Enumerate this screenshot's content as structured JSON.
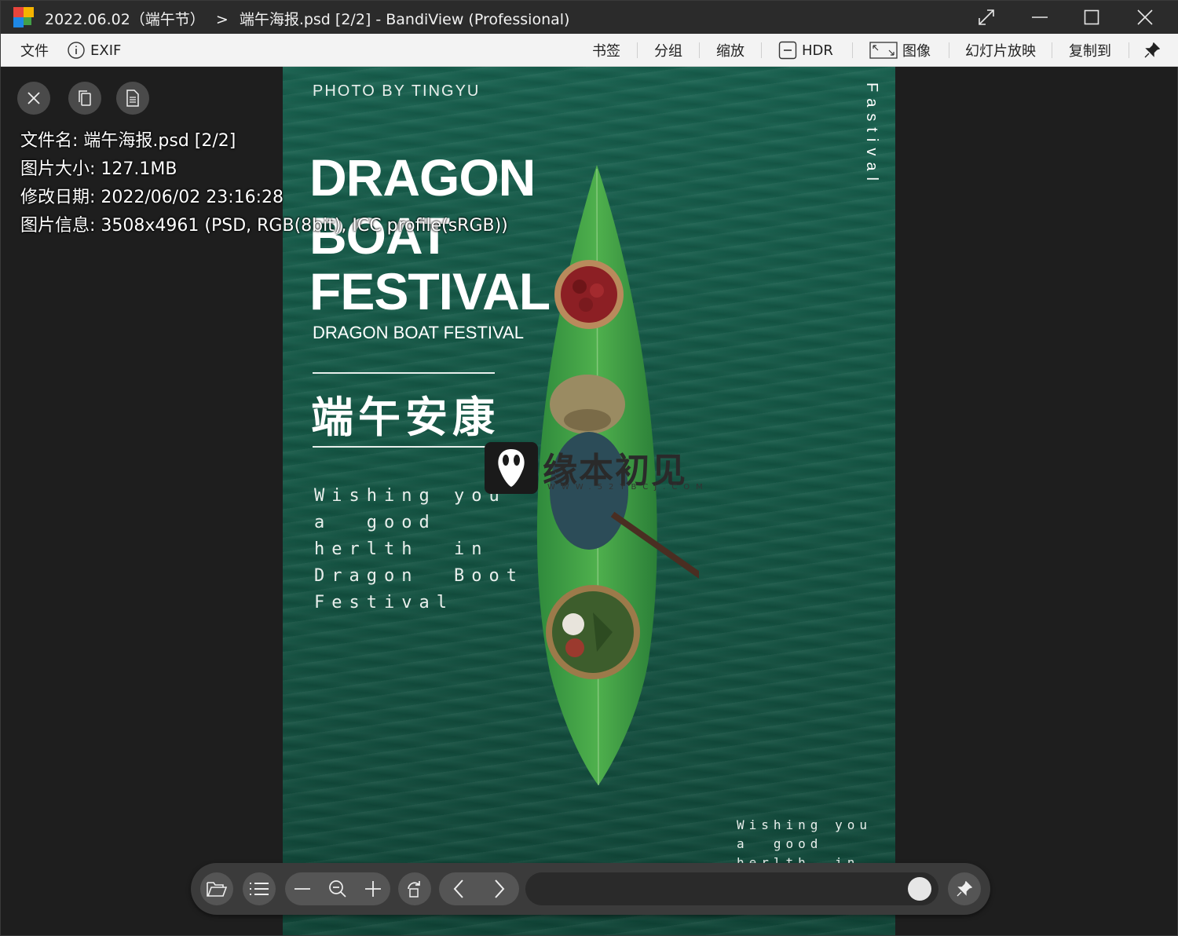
{
  "window": {
    "title_path": "2022.06.02（端午节）",
    "title_sep": ">",
    "title_file": "端午海报.psd [2/2] - BandiView (Professional)"
  },
  "menu": {
    "file": "文件",
    "exif": "EXIF",
    "bookmark": "书签",
    "group": "分组",
    "zoom": "缩放",
    "hdr": "HDR",
    "image": "图像",
    "slideshow": "幻灯片放映",
    "copy_to": "复制到"
  },
  "info": {
    "filename": "文件名: 端午海报.psd [2/2]",
    "size": "图片大小: 127.1MB",
    "modified": "修改日期: 2022/06/02 23:16:28",
    "details": "图片信息: 3508x4961 (PSD, RGB(8bit), ICC profile(sRGB))"
  },
  "poster": {
    "photo_by": "PHOTO BY TINGYU",
    "line1": "DRAGON",
    "line2": "BOAT",
    "line3": "FESTIVAL",
    "subtitle": "DRAGON BOAT FESTIVAL",
    "chinese": "端午安康",
    "wish": "Wishing you\na  good\nherlth  in\nDragon  Boot\nFestival",
    "vertical": "Fastival",
    "wish_small": "Wishing you\na  good\nherlth  in"
  },
  "watermark": {
    "text": "缘本初见",
    "url": "WWW.52YBCJ.COM"
  },
  "colors": {
    "poster_green": "#145745",
    "titlebar": "#2b2b2b",
    "menubar": "#f3f3f3",
    "toolbar": "#3b3b3b"
  },
  "icons": [
    "app-icon",
    "maximize-diagonal-icon",
    "minimize-icon",
    "maximize-icon",
    "close-icon",
    "info-icon",
    "hdr-icon",
    "image-resize-icon",
    "pin-icon",
    "close-circle-icon",
    "copy-icon",
    "document-icon",
    "folder-open-icon",
    "list-icon",
    "minus-icon",
    "zoom-out-icon",
    "plus-icon",
    "rotate-icon",
    "chevron-left-icon",
    "chevron-right-icon"
  ]
}
